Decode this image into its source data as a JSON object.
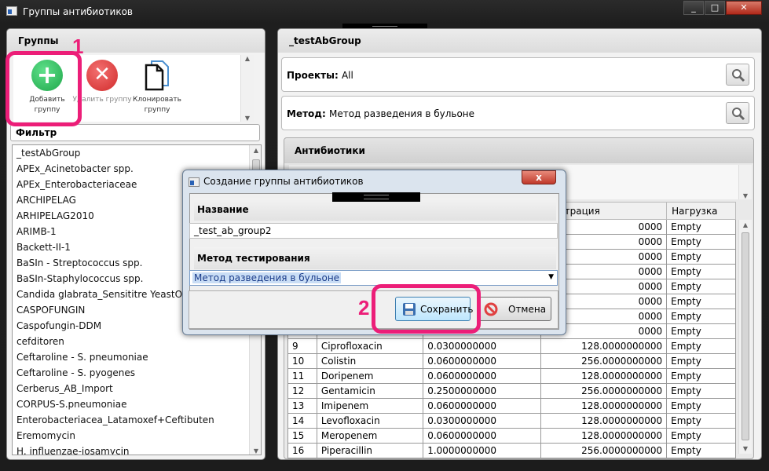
{
  "window": {
    "title": "Группы антибиотиков",
    "min": "_",
    "max": "□",
    "close": "✕"
  },
  "groups_panel": {
    "header": "Группы",
    "toolbar": {
      "add": "Добавить группу",
      "delete": "Удалить группу",
      "clone": "Клонировать группу"
    },
    "filter_label": "Фильтр",
    "items": [
      "_testAbGroup",
      "APEx_Acinetobacter spp.",
      "APEx_Enterobacteriaceae",
      "ARCHIPELAG",
      "ARHIPELAG2010",
      "ARIMB-1",
      "Backett-II-1",
      "BaSIn - Streptococcus spp.",
      "BaSIn-Staphylococcus spp.",
      "Candida glabrata_Sensititre YeastOne10",
      "CASPOFUNGIN",
      "Caspofungin-DDM",
      "cefditoren",
      "Ceftaroline - S. pneumoniae",
      "Ceftaroline - S. pyogenes",
      "Cerberus_AB_Import",
      "CORPUS-S.pneumoniae",
      "Enterobacteriacea_Latamoxef+Ceftibuten",
      "Eremomycin",
      "H. influenzae-josamycin"
    ]
  },
  "detail": {
    "group_name": "_testAbGroup",
    "projects_label": "Проекты:",
    "projects_value": "All",
    "method_label": "Метод:",
    "method_value": "Метод разведения в бульоне",
    "antibiotics_header": "Антибиотики",
    "columns": [
      "",
      "",
      "",
      "центрация",
      "Нагрузка"
    ],
    "rows": [
      [
        "",
        "",
        "",
        "0000",
        "Empty"
      ],
      [
        "",
        "",
        "",
        "0000",
        "Empty"
      ],
      [
        "",
        "",
        "",
        "0000",
        "Empty"
      ],
      [
        "",
        "",
        "",
        "0000",
        "Empty"
      ],
      [
        "",
        "",
        "",
        "0000",
        "Empty"
      ],
      [
        "",
        "",
        "",
        "0000",
        "Empty"
      ],
      [
        "",
        "",
        "",
        "0000",
        "Empty"
      ],
      [
        "",
        "",
        "",
        "0000",
        "Empty"
      ],
      [
        "9",
        "Ciprofloxacin",
        "0.0300000000",
        "128.0000000000",
        "Empty"
      ],
      [
        "10",
        "Colistin",
        "0.0600000000",
        "256.0000000000",
        "Empty"
      ],
      [
        "11",
        "Doripenem",
        "0.0600000000",
        "128.0000000000",
        "Empty"
      ],
      [
        "12",
        "Gentamicin",
        "0.2500000000",
        "256.0000000000",
        "Empty"
      ],
      [
        "13",
        "Imipenem",
        "0.0600000000",
        "128.0000000000",
        "Empty"
      ],
      [
        "14",
        "Levofloxacin",
        "0.0300000000",
        "128.0000000000",
        "Empty"
      ],
      [
        "15",
        "Meropenem",
        "0.0600000000",
        "128.0000000000",
        "Empty"
      ],
      [
        "16",
        "Piperacillin",
        "1.0000000000",
        "256.0000000000",
        "Empty"
      ]
    ]
  },
  "dialog": {
    "title": "Создание группы антибиотиков",
    "close": "x",
    "name_label": "Название",
    "name_value": "_test_ab_group2",
    "method_label": "Метод тестирования",
    "method_value": "Метод разведения в бульоне",
    "save": "Сохранить",
    "cancel": "Отмена"
  },
  "annotations": {
    "step1": "1",
    "step2": "2"
  },
  "colors": {
    "highlight": "#ec1e78",
    "add_green": "#1fa74a",
    "delete_red": "#d12b2b"
  }
}
